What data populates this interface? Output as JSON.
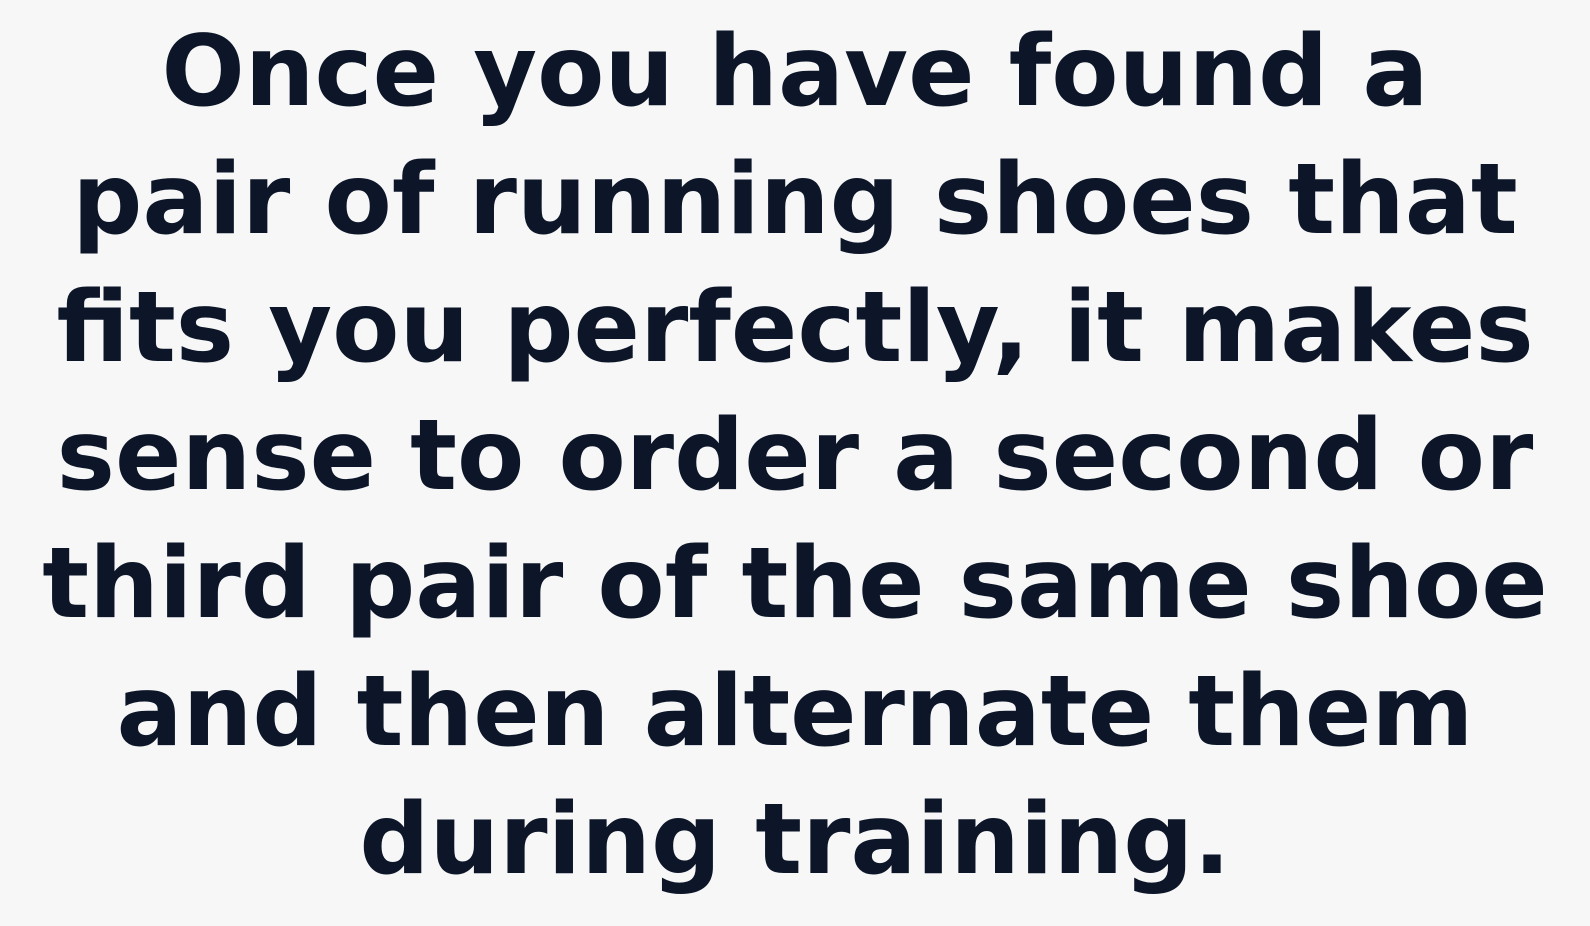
{
  "quote": {
    "lines": [
      "Once you have found a",
      "pair of running shoes that",
      "fits you perfectly, it makes",
      "sense to order a second or",
      "third pair of the same shoe",
      "and then alternate them",
      "during training."
    ]
  },
  "colors": {
    "background": "#f7f7f7",
    "text": "#0c1628"
  }
}
